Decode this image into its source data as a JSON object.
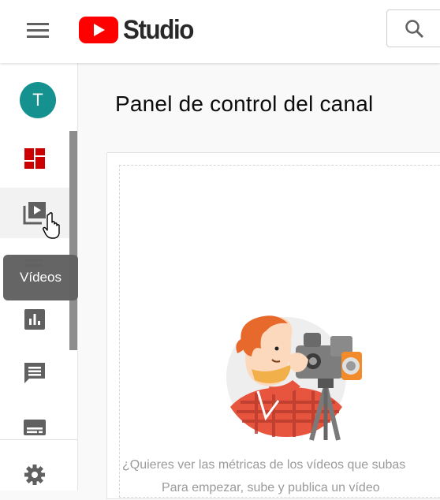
{
  "header": {
    "logo_text": "Studio",
    "brand_color": "#ff0000"
  },
  "sidebar": {
    "avatar_letter": "T",
    "items": [
      {
        "name": "dashboard-icon",
        "color": "#cc0000"
      },
      {
        "name": "videos-icon"
      },
      {
        "name": "playlists-icon"
      },
      {
        "name": "analytics-icon"
      },
      {
        "name": "comments-icon"
      },
      {
        "name": "subtitles-icon"
      },
      {
        "name": "settings-icon"
      }
    ],
    "tooltip": "Vídeos"
  },
  "main": {
    "title": "Panel de control del canal",
    "empty_state": {
      "line1": "¿Quieres ver las métricas de los vídeos que subas",
      "line2": "Para empezar, sube y publica un vídeo"
    }
  }
}
